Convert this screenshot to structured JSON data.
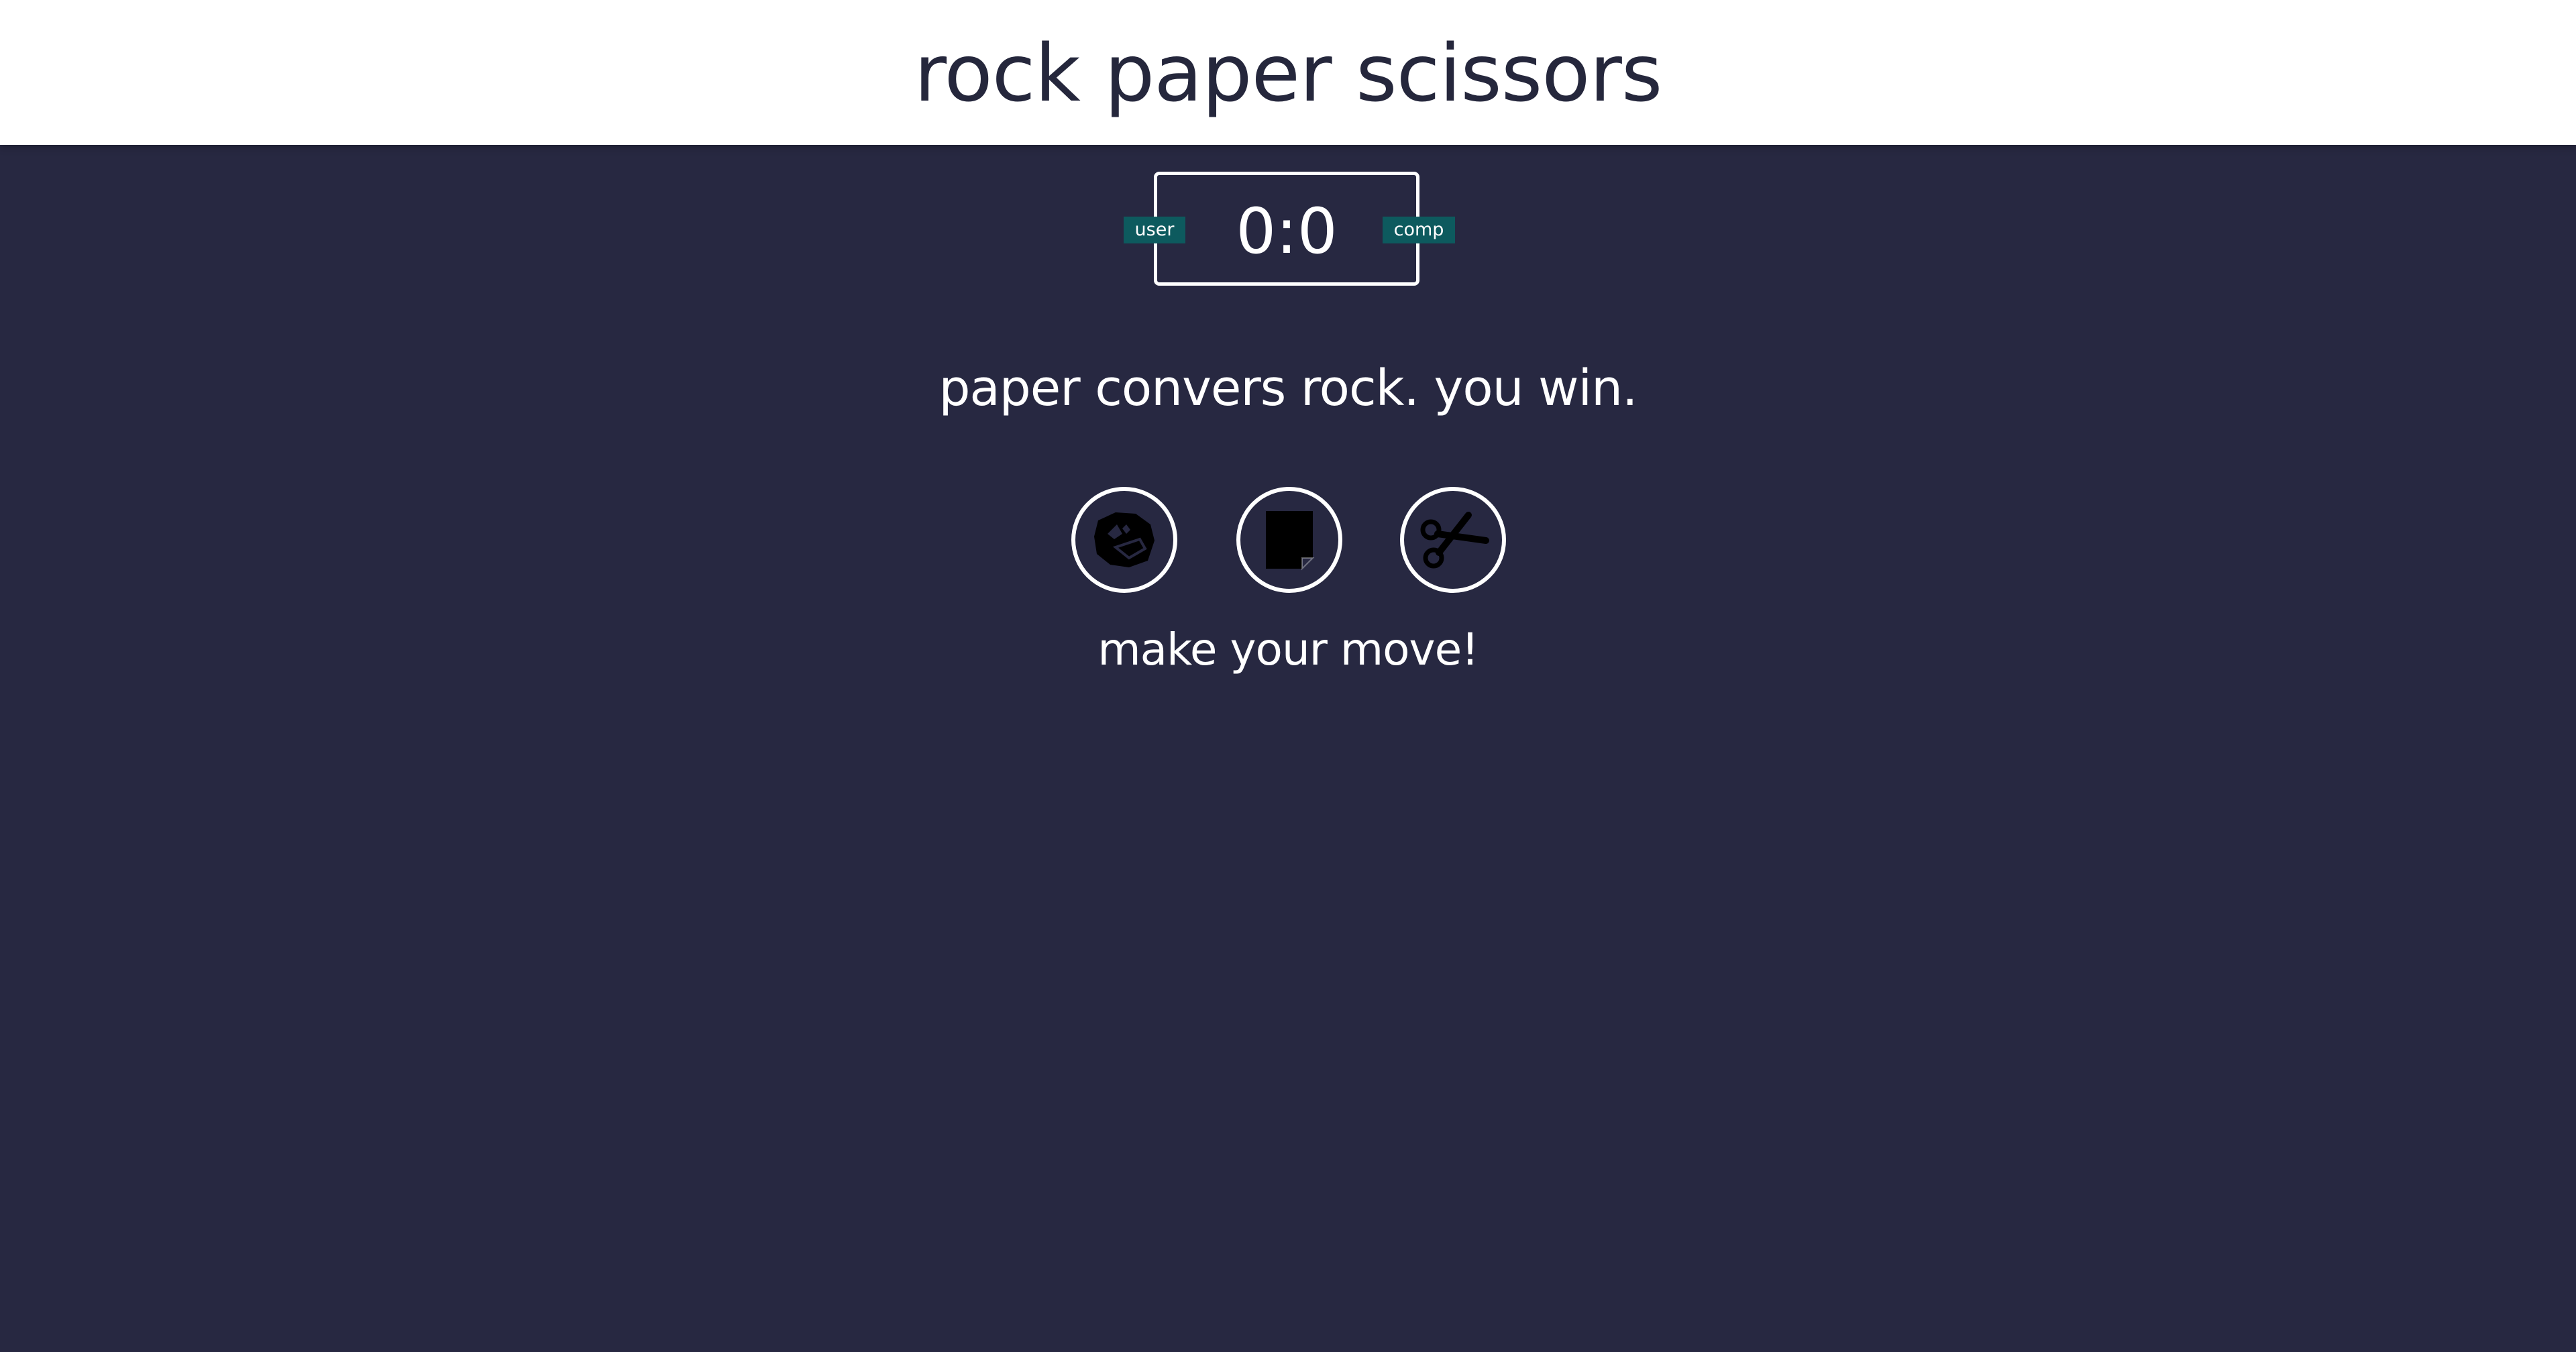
{
  "header": {
    "title": "rock paper scissors"
  },
  "score_board": {
    "user_label": "user",
    "comp_label": "comp",
    "score": "0:0",
    "user_score": 0,
    "comp_score": 0
  },
  "result": {
    "message": "paper convers rock. you win."
  },
  "choices": [
    {
      "id": "rock",
      "icon": "rock-icon"
    },
    {
      "id": "paper",
      "icon": "paper-icon"
    },
    {
      "id": "scissors",
      "icon": "scissors-icon"
    }
  ],
  "action_message": "make your move!",
  "colors": {
    "background": "#272841",
    "header_bg": "#ffffff",
    "title_text": "#25273c",
    "badge_bg": "#0d5a5e",
    "text": "#ffffff"
  }
}
